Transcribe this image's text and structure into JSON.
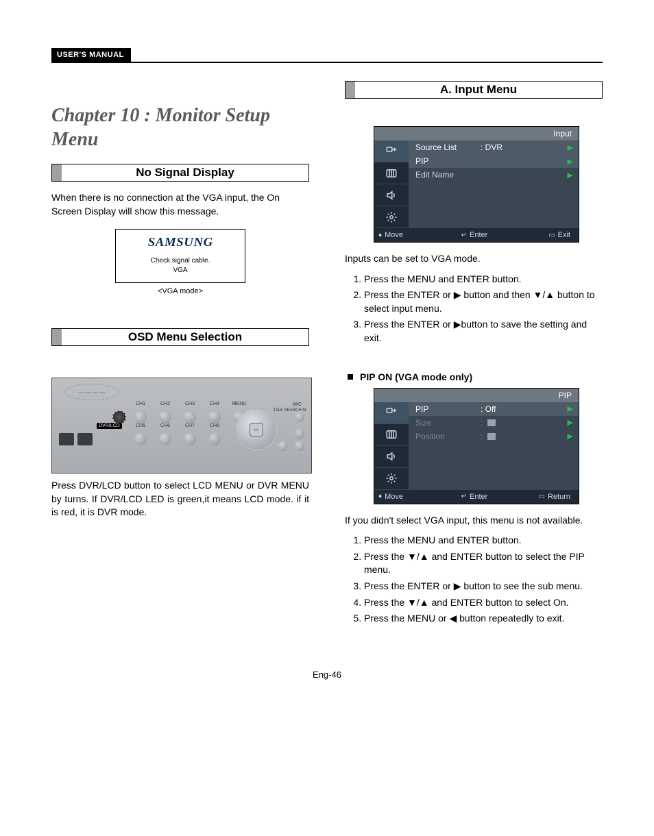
{
  "header": {
    "label": "USER'S MANUAL"
  },
  "chapter_title": "Chapter 10 : Monitor Setup Menu",
  "left": {
    "sec1": {
      "title": "No Signal Display",
      "body": "When there is no connection at the VGA input, the On Screen Display will show this message.",
      "box": {
        "brand": "SAMSUNG",
        "line1": "Check signal cable.",
        "line2": "VGA"
      },
      "caption": "<VGA mode>"
    },
    "sec2": {
      "title": "OSD Menu Selection",
      "body": "Press DVR/LCD button to select LCD MENU or DVR MENU by turns. If DVR/LCD LED is green,it means LCD mode. if it is red, it is DVR mode."
    },
    "panel": {
      "ch": [
        "CH1",
        "CH2",
        "CH3",
        "CH4",
        "MENU"
      ],
      "ch2": [
        "CH5",
        "CH6",
        "CH7",
        "CH8"
      ],
      "dvrlcd": "DVR/LCD",
      "mic": "MIC",
      "right_labels": "TALK SEARCH M."
    }
  },
  "right": {
    "sec1": {
      "title": "A. Input Menu"
    },
    "osd1": {
      "title": "Input",
      "rows": [
        {
          "label": "Source List",
          "value": ": DVR",
          "arrow": true,
          "hl": true
        },
        {
          "label": "PIP",
          "value": "",
          "arrow": true,
          "hl": true
        },
        {
          "label": "Edit Name",
          "value": "",
          "arrow": true,
          "hl": false
        }
      ],
      "footer": {
        "move": "Move",
        "enter": "Enter",
        "exit": "Exit"
      }
    },
    "note1": "Inputs can be set to VGA mode.",
    "steps1": [
      "Press the MENU and ENTER button.",
      "Press the ENTER or ▶ button and then ▼/▲ button to select input menu.",
      "Press the ENTER or ▶button to save the setting and exit."
    ],
    "pip_head": "PIP ON (VGA mode only)",
    "osd2": {
      "title": "PIP",
      "rows": [
        {
          "label": "PIP",
          "value": ": Off",
          "arrow": true,
          "hl": true,
          "muted": false
        },
        {
          "label": "Size",
          "value_icon": true,
          "arrow": true,
          "hl": false,
          "muted": true
        },
        {
          "label": "Position",
          "value_icon": true,
          "arrow": true,
          "hl": false,
          "muted": true
        }
      ],
      "footer": {
        "move": "Move",
        "enter": "Enter",
        "exit": "Return"
      }
    },
    "note2": "If you didn't select VGA input, this menu is not available.",
    "steps2": [
      "Press the MENU and ENTER button.",
      "Press the ▼/▲ and ENTER button to select the PIP menu.",
      "Press the ENTER or ▶ button to see the sub menu.",
      "Press the ▼/▲ and ENTER button to select On.",
      "Press the MENU or ◀ button repeatedly to exit."
    ]
  },
  "footer": "Eng-46"
}
